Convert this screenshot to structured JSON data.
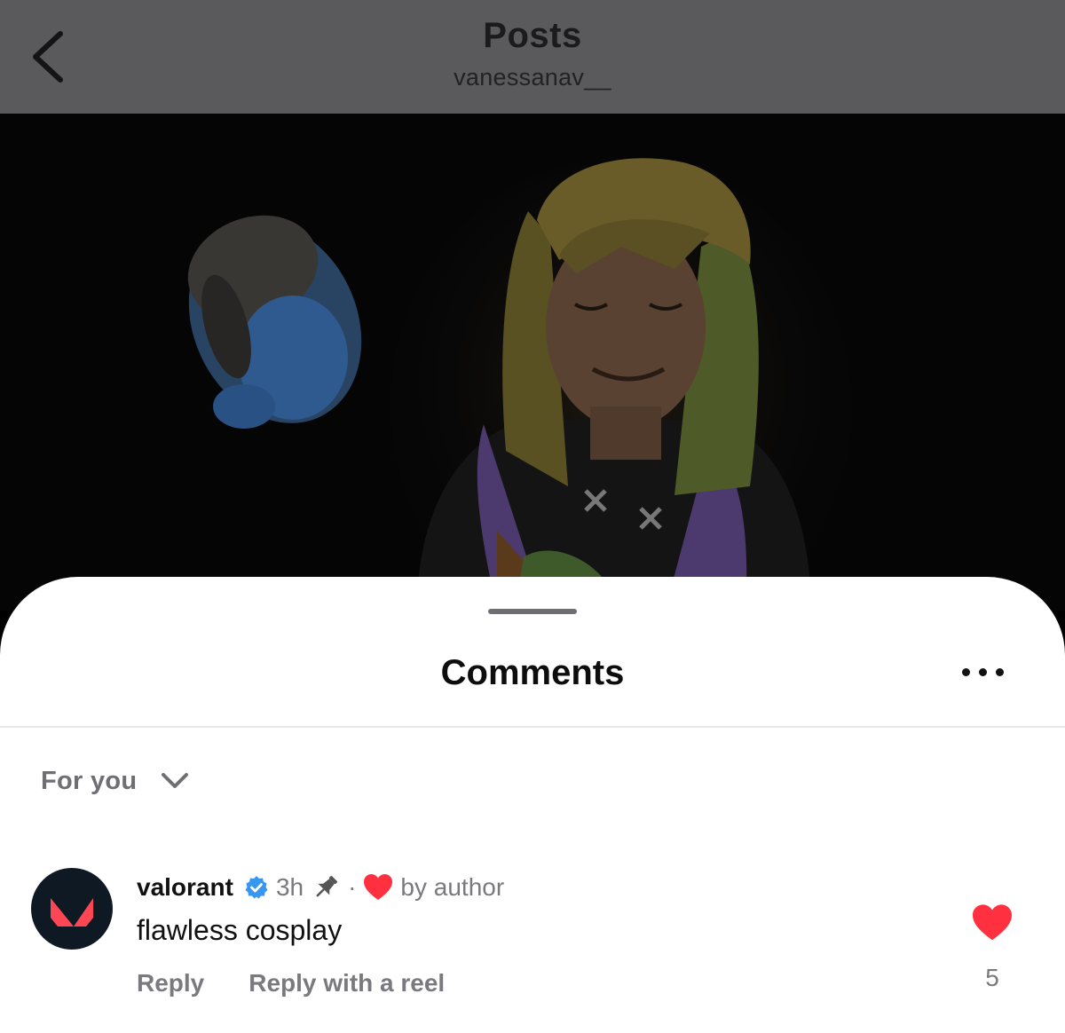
{
  "header": {
    "title": "Posts",
    "subtitle": "vanessanav__"
  },
  "comments_sheet": {
    "title": "Comments",
    "sort_label": "For you"
  },
  "comment": {
    "username": "valorant",
    "verified": true,
    "time": "3h",
    "separator": "·",
    "liked_by": "by author",
    "text": "flawless cosplay",
    "reply_label": "Reply",
    "reply_reel_label": "Reply with a reel",
    "like_count": "5"
  },
  "colors": {
    "verified_blue": "#3797f0",
    "like_red": "#ff3040",
    "valorant_red": "#ff4655",
    "avatar_bg": "#0f1923"
  },
  "icons": {
    "back": "chevron-left-icon",
    "more": "more-horizontal-icon",
    "sort": "chevron-down-icon",
    "verified": "verified-badge-icon",
    "pinned": "pin-icon",
    "author_liked": "heart-filled-icon",
    "like": "heart-filled-icon"
  }
}
